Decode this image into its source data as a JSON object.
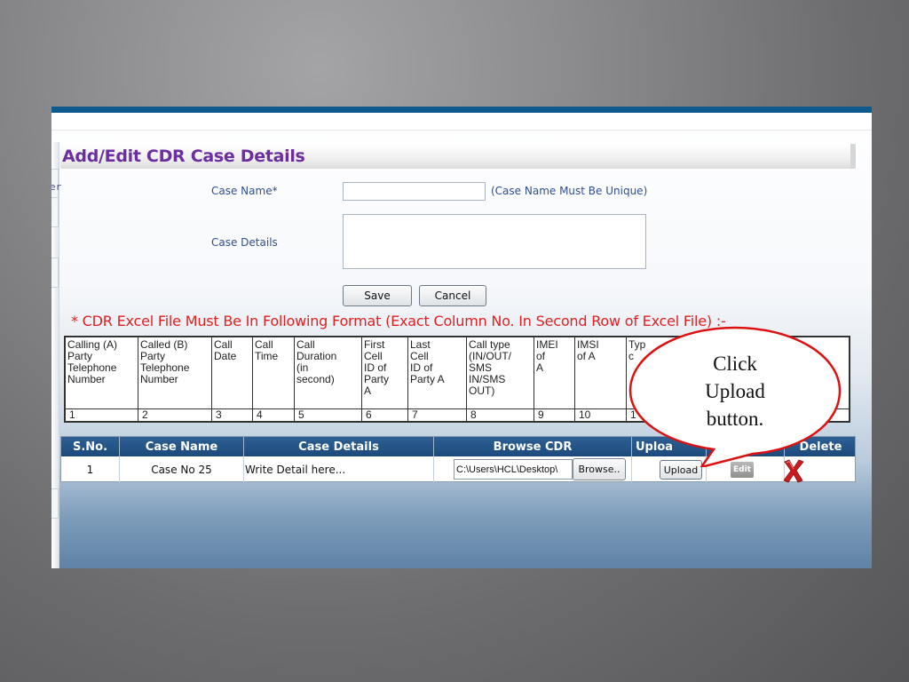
{
  "form": {
    "title": "Add/Edit CDR Case Details",
    "side_label": "er",
    "case_name_label": "Case Name*",
    "case_name_value": "",
    "case_name_hint": "(Case Name Must Be Unique)",
    "case_details_label": "Case Details",
    "case_details_value": "",
    "save_label": "Save",
    "cancel_label": "Cancel"
  },
  "format_note": "* CDR Excel File Must Be In Following Format (Exact Column No. In Second Row of Excel File) :-",
  "format_table": {
    "columns": [
      {
        "header": "Calling (A)\nParty\nTelephone\nNumber",
        "no": "1"
      },
      {
        "header": "Called (B)\nParty\nTelephone\nNumber",
        "no": "2"
      },
      {
        "header": "Call\nDate",
        "no": "3"
      },
      {
        "header": "Call\nTime",
        "no": "4"
      },
      {
        "header": "Call\nDuration\n(in\nsecond)",
        "no": "5"
      },
      {
        "header": "First\nCell\nID of\nParty\nA",
        "no": "6"
      },
      {
        "header": "Last\nCell\nID of\nParty A",
        "no": "7"
      },
      {
        "header": "Call type\n(IN/OUT/\nSMS\nIN/SMS\nOUT)",
        "no": "8"
      },
      {
        "header": "IMEI\nof\nA",
        "no": "9"
      },
      {
        "header": "IMSI\nof A",
        "no": "10"
      },
      {
        "header": "Typ\nc",
        "no": "1"
      }
    ]
  },
  "case_grid": {
    "headers": {
      "sno": "S.No.",
      "case_name": "Case Name",
      "case_details": "Case Details",
      "browse_cdr": "Browse CDR",
      "upload": "Uploa",
      "delete": "Delete"
    },
    "row": {
      "sno": "1",
      "case_name": "Case No 25",
      "case_details": "Write Detail here...",
      "file_path": "C:\\Users\\HCL\\Desktop\\",
      "browse_label": "Browse..",
      "upload_label": "Upload",
      "edit_label": "Edit"
    }
  },
  "callout": {
    "text": "Click\nUpload\nbutton."
  },
  "colors": {
    "title": "#6b2fa0",
    "label": "#2f4f8f",
    "note_red": "#e02020",
    "grid_header": "#1d4a7d",
    "callout_border": "#dd1111",
    "top_bar": "#0d5b8e"
  },
  "icons": {
    "delete": "red-x-icon",
    "edit": "edit-icon"
  }
}
